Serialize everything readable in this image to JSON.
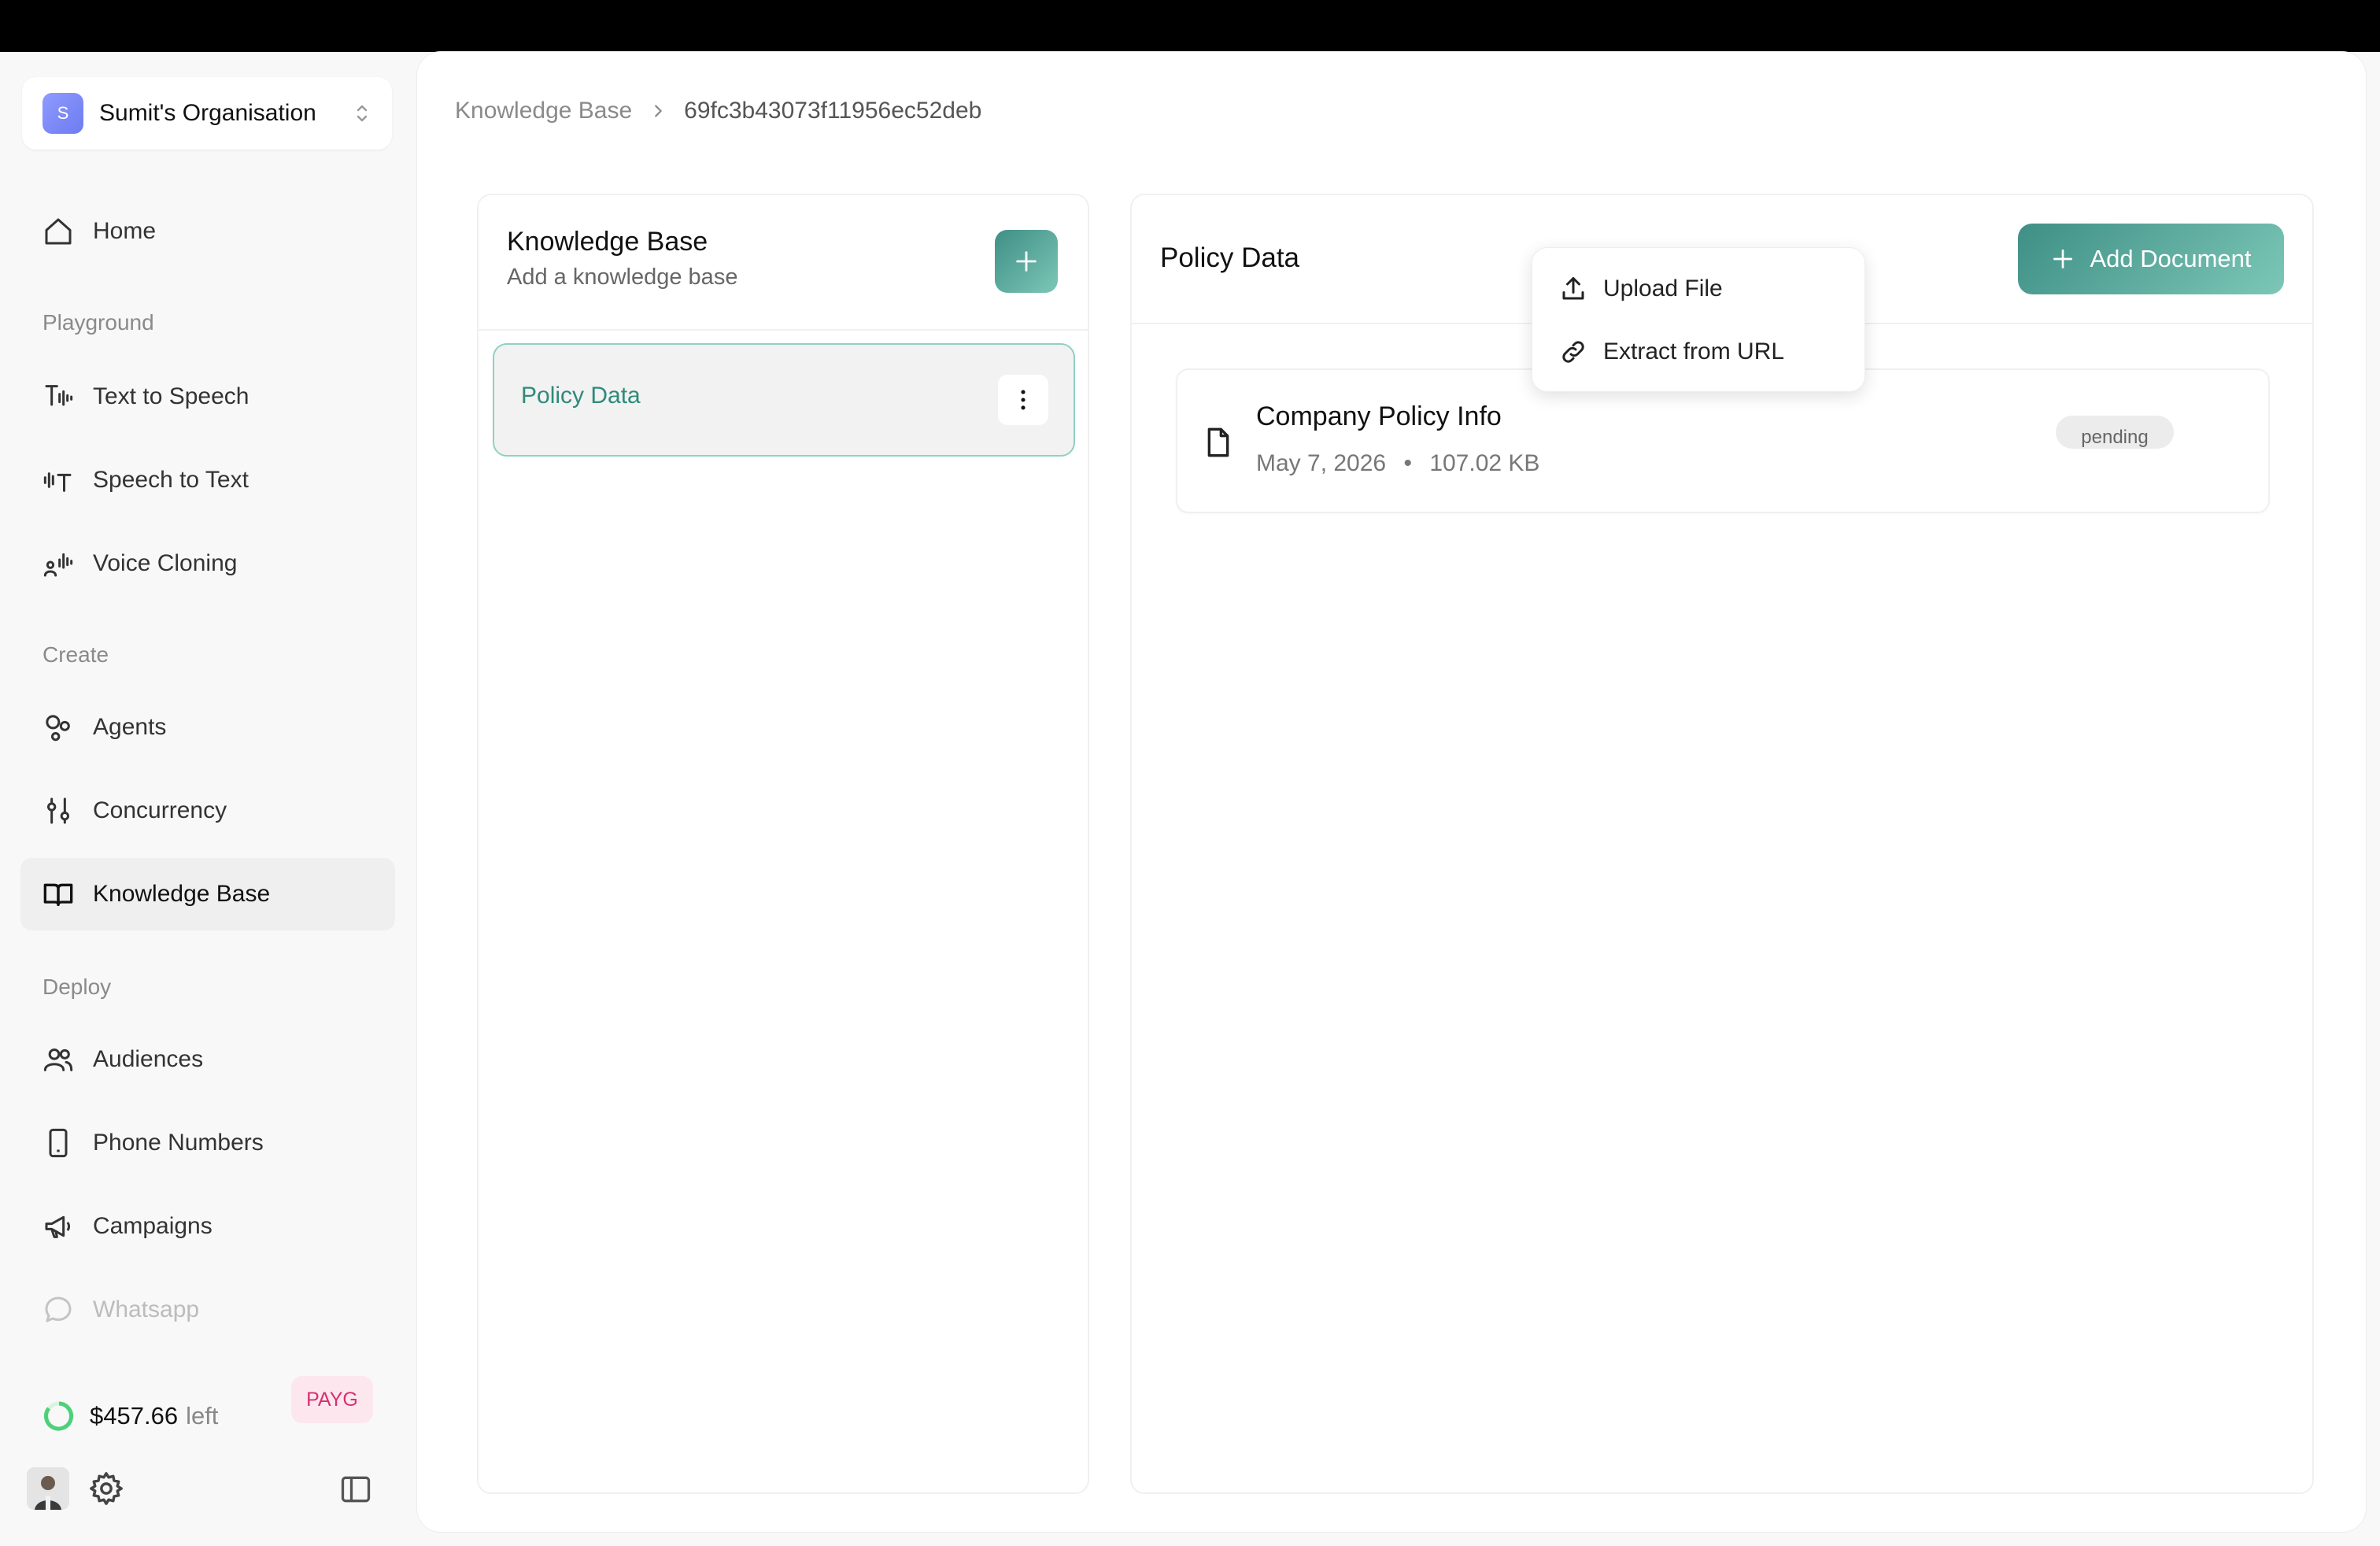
{
  "org": {
    "initial": "S",
    "name": "Sumit's Organisation"
  },
  "nav": {
    "home": "Home",
    "section_playground": "Playground",
    "text_to_speech": "Text to Speech",
    "speech_to_text": "Speech to Text",
    "voice_cloning": "Voice Cloning",
    "section_create": "Create",
    "agents": "Agents",
    "concurrency": "Concurrency",
    "knowledge_base": "Knowledge Base",
    "section_deploy": "Deploy",
    "audiences": "Audiences",
    "phone_numbers": "Phone Numbers",
    "campaigns": "Campaigns",
    "whatsapp": "Whatsapp"
  },
  "credits": {
    "amount": "$457.66",
    "suffix": "left",
    "plan": "PAYG"
  },
  "breadcrumb": {
    "root": "Knowledge Base",
    "current": "69fc3b43073f11956ec52deb"
  },
  "kb_panel": {
    "title": "Knowledge Base",
    "subtitle": "Add a knowledge base",
    "items": [
      {
        "label": "Policy Data"
      }
    ]
  },
  "doc_panel": {
    "title": "Policy Data",
    "add_label": "Add Document",
    "documents": [
      {
        "name": "Company Policy Info",
        "date": "May 7, 2026",
        "size": "107.02 KB",
        "status": "pending"
      }
    ]
  },
  "dropdown": {
    "upload": "Upload File",
    "extract": "Extract from URL"
  },
  "colors": {
    "accent": "#3f8f86",
    "accent_light": "#7cc7b7",
    "payg_text": "#d6306e"
  }
}
